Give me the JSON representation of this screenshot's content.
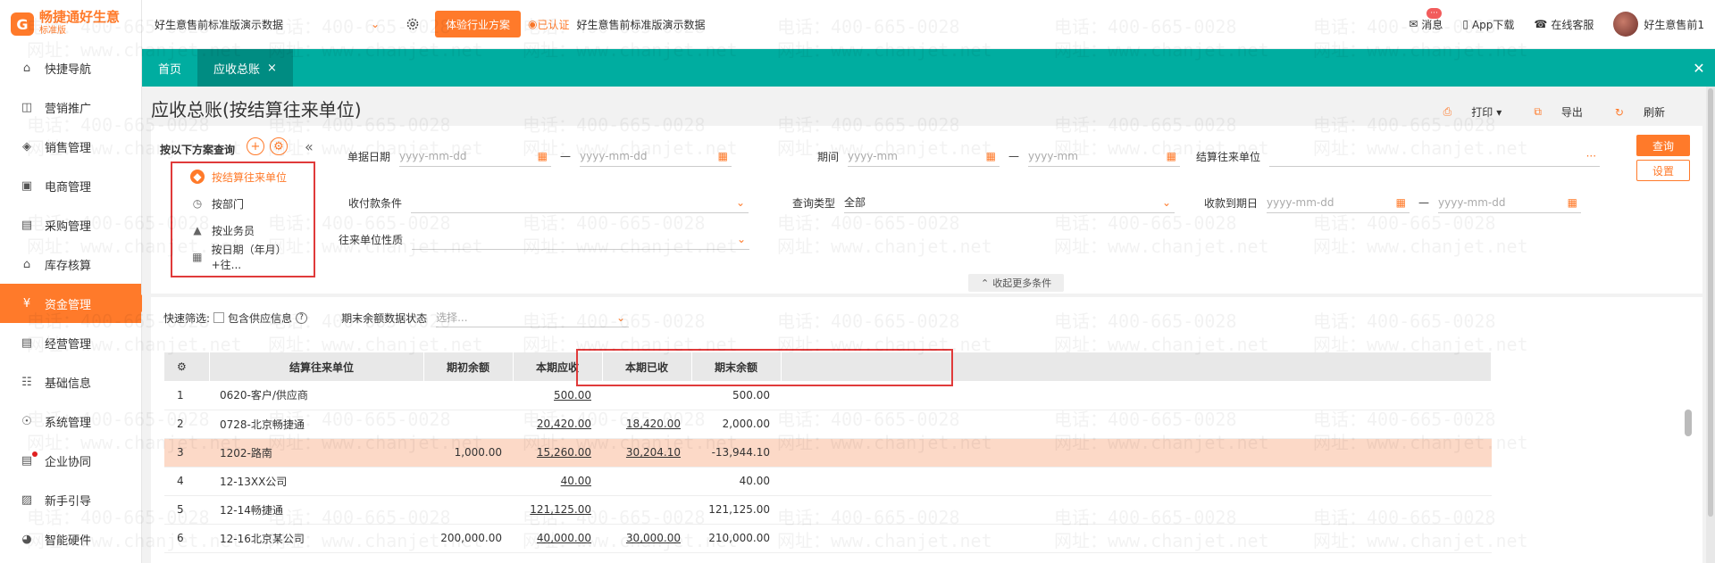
{
  "brand": {
    "name": "畅捷通好生意",
    "edition": "标准版",
    "mark": "G"
  },
  "sidebar": {
    "items": [
      {
        "label": "快捷导航",
        "icon": "home-icon"
      },
      {
        "label": "营销推广",
        "icon": "gift-icon"
      },
      {
        "label": "销售管理",
        "icon": "sales-icon"
      },
      {
        "label": "电商管理",
        "icon": "store-icon"
      },
      {
        "label": "采购管理",
        "icon": "bag-icon"
      },
      {
        "label": "库存核算",
        "icon": "warehouse-icon"
      },
      {
        "label": "资金管理",
        "icon": "money-icon",
        "active": true
      },
      {
        "label": "经营管理",
        "icon": "report-icon"
      },
      {
        "label": "基础信息",
        "icon": "info-icon"
      },
      {
        "label": "系统管理",
        "icon": "system-icon"
      },
      {
        "label": "企业协同",
        "icon": "collab-icon",
        "dot": true
      },
      {
        "label": "新手引导",
        "icon": "guide-icon"
      },
      {
        "label": "智能硬件",
        "icon": "hardware-icon"
      }
    ]
  },
  "topbar": {
    "account": "好生意售前标准版演示数据",
    "trial_label": "体验行业方案",
    "verified_label": "已认证",
    "company": "好生意售前标准版演示数据",
    "message_label": "消息",
    "message_badge": "···",
    "app_label": "App下载",
    "service_label": "在线客服",
    "user": "好生意售前1"
  },
  "tabs": [
    {
      "label": "首页"
    },
    {
      "label": "应收总账",
      "active": true,
      "close": "×"
    }
  ],
  "tab_close_all": "✕",
  "page": {
    "title": "应收总账(按结算往来单位)",
    "print_label": "打印",
    "export_label": "导出",
    "refresh_label": "刷新"
  },
  "filter": {
    "scheme_title": "按以下方案查询",
    "schemes": [
      {
        "label": "按结算往来单位",
        "active": true
      },
      {
        "label": "按部门"
      },
      {
        "label": "按业务员"
      },
      {
        "label": "按日期（年月）+往..."
      }
    ],
    "doc_date_label": "单据日期",
    "date_placeholder": "yyyy-mm-dd",
    "period_label": "期间",
    "period_placeholder": "yyyy-mm",
    "partner_label": "结算往来单位",
    "partner_more": "···",
    "pay_cond_label": "收付款条件",
    "query_type_label": "查询类型",
    "query_type_value": "全部",
    "due_date_label": "收款到期日",
    "nature_label": "往来单位性质",
    "query_btn": "查询",
    "setting_btn": "设置",
    "more_btn": "收起更多条件",
    "dash": "—"
  },
  "grid": {
    "quick_label": "快速筛选:",
    "include_supply_label": "包含供应信息",
    "end_status_label": "期末余额数据状态",
    "end_status_placeholder": "选择...",
    "columns": [
      "结算往来单位",
      "期初余额",
      "本期应收",
      "本期已收",
      "期末余额"
    ],
    "rows": [
      {
        "idx": "1",
        "name": "0620-客户/供应商",
        "opening": "",
        "due": "500.00",
        "received": "",
        "closing": "500.00"
      },
      {
        "idx": "2",
        "name": "0728-北京畅捷通",
        "opening": "",
        "due": "20,420.00",
        "received": "18,420.00",
        "closing": "2,000.00"
      },
      {
        "idx": "3",
        "name": "1202-路南",
        "opening": "1,000.00",
        "due": "15,260.00",
        "received": "30,204.10",
        "closing": "-13,944.10",
        "highlight": true
      },
      {
        "idx": "4",
        "name": "12-13XX公司",
        "opening": "",
        "due": "40.00",
        "received": "",
        "closing": "40.00"
      },
      {
        "idx": "5",
        "name": "12-14畅捷通",
        "opening": "",
        "due": "121,125.00",
        "received": "",
        "closing": "121,125.00"
      },
      {
        "idx": "6",
        "name": "12-16北京某公司",
        "opening": "200,000.00",
        "due": "40,000.00",
        "received": "30,000.00",
        "closing": "210,000.00"
      }
    ]
  },
  "watermark": {
    "phone": "电话：400-665-0028",
    "site": "网址：www.chanjet.net"
  }
}
